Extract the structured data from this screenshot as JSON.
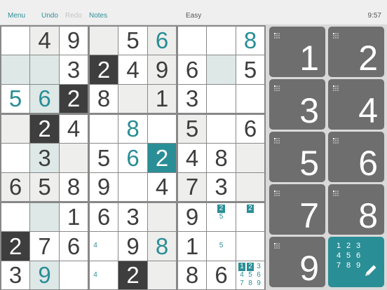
{
  "toolbar": {
    "menu": "Menu",
    "undo": "Undo",
    "redo": "Redo",
    "notes": "Notes",
    "difficulty": "Easy",
    "time": "9:57"
  },
  "colors": {
    "accent": "#2a8e96",
    "given_dark": "#3e3e3e",
    "key": "#6e6e6e"
  },
  "board": [
    [
      {
        "v": "",
        "bg": "w"
      },
      {
        "v": "4",
        "bg": "g"
      },
      {
        "v": "9",
        "bg": "w"
      },
      {
        "v": "",
        "bg": "g"
      },
      {
        "v": "5",
        "bg": "w"
      },
      {
        "v": "6",
        "bg": "g",
        "u": true
      },
      {
        "v": "",
        "bg": "w"
      },
      {
        "v": "",
        "bg": "w"
      },
      {
        "v": "8",
        "bg": "w",
        "u": true
      }
    ],
    [
      {
        "v": "",
        "bg": "b"
      },
      {
        "v": "",
        "bg": "b"
      },
      {
        "v": "3",
        "bg": "w"
      },
      {
        "v": "2",
        "bg": "d"
      },
      {
        "v": "4",
        "bg": "w"
      },
      {
        "v": "9",
        "bg": "g"
      },
      {
        "v": "6",
        "bg": "w"
      },
      {
        "v": "",
        "bg": "b"
      },
      {
        "v": "5",
        "bg": "w"
      }
    ],
    [
      {
        "v": "5",
        "bg": "w",
        "u": true
      },
      {
        "v": "6",
        "bg": "b",
        "u": true
      },
      {
        "v": "2",
        "bg": "d"
      },
      {
        "v": "8",
        "bg": "w"
      },
      {
        "v": "",
        "bg": "g"
      },
      {
        "v": "1",
        "bg": "g"
      },
      {
        "v": "3",
        "bg": "w"
      },
      {
        "v": "",
        "bg": "w"
      },
      {
        "v": "",
        "bg": "w"
      }
    ],
    [
      {
        "v": "",
        "bg": "g"
      },
      {
        "v": "2",
        "bg": "d"
      },
      {
        "v": "4",
        "bg": "w"
      },
      {
        "v": "",
        "bg": "w"
      },
      {
        "v": "8",
        "bg": "w",
        "u": true
      },
      {
        "v": "",
        "bg": "w"
      },
      {
        "v": "5",
        "bg": "g"
      },
      {
        "v": "",
        "bg": "w"
      },
      {
        "v": "6",
        "bg": "w"
      }
    ],
    [
      {
        "v": "",
        "bg": "w"
      },
      {
        "v": "3",
        "bg": "b"
      },
      {
        "v": "",
        "bg": "g"
      },
      {
        "v": "5",
        "bg": "w"
      },
      {
        "v": "6",
        "bg": "w",
        "u": true
      },
      {
        "v": "2",
        "bg": "t"
      },
      {
        "v": "4",
        "bg": "w"
      },
      {
        "v": "8",
        "bg": "w"
      },
      {
        "v": "",
        "bg": "g"
      }
    ],
    [
      {
        "v": "6",
        "bg": "g"
      },
      {
        "v": "5",
        "bg": "g"
      },
      {
        "v": "8",
        "bg": "w"
      },
      {
        "v": "9",
        "bg": "w"
      },
      {
        "v": "",
        "bg": "w"
      },
      {
        "v": "4",
        "bg": "w"
      },
      {
        "v": "7",
        "bg": "g"
      },
      {
        "v": "3",
        "bg": "w"
      },
      {
        "v": "",
        "bg": "g"
      }
    ],
    [
      {
        "v": "",
        "bg": "w"
      },
      {
        "v": "",
        "bg": "b"
      },
      {
        "v": "1",
        "bg": "w"
      },
      {
        "v": "6",
        "bg": "w"
      },
      {
        "v": "3",
        "bg": "w"
      },
      {
        "v": "",
        "bg": "g"
      },
      {
        "v": "9",
        "bg": "w"
      },
      {
        "v": "",
        "bg": "w",
        "n": [
          "",
          "2",
          "",
          "",
          "5",
          "",
          "",
          "",
          ""
        ],
        "h": [
          1
        ]
      },
      {
        "v": "",
        "bg": "w",
        "n": [
          "",
          "2",
          "",
          "",
          "",
          "",
          "",
          "",
          ""
        ],
        "h": [
          1
        ]
      }
    ],
    [
      {
        "v": "2",
        "bg": "d"
      },
      {
        "v": "7",
        "bg": "w"
      },
      {
        "v": "6",
        "bg": "w"
      },
      {
        "v": "",
        "bg": "w",
        "n": [
          "",
          "",
          "",
          "4",
          "",
          "",
          "",
          "",
          ""
        ]
      },
      {
        "v": "9",
        "bg": "w"
      },
      {
        "v": "8",
        "bg": "g",
        "u": true
      },
      {
        "v": "1",
        "bg": "w"
      },
      {
        "v": "",
        "bg": "w",
        "n": [
          "",
          "",
          "",
          "",
          "5",
          "",
          "",
          "",
          ""
        ]
      },
      {
        "v": "",
        "bg": "w"
      }
    ],
    [
      {
        "v": "3",
        "bg": "w"
      },
      {
        "v": "9",
        "bg": "b",
        "u": true
      },
      {
        "v": "",
        "bg": "w"
      },
      {
        "v": "",
        "bg": "w",
        "n": [
          "",
          "",
          "",
          "4",
          "",
          "",
          "",
          "",
          ""
        ]
      },
      {
        "v": "2",
        "bg": "d"
      },
      {
        "v": "",
        "bg": "g"
      },
      {
        "v": "8",
        "bg": "w"
      },
      {
        "v": "6",
        "bg": "w"
      },
      {
        "v": "",
        "bg": "w",
        "n": [
          "1",
          "2",
          "3",
          "4",
          "5",
          "6",
          "7",
          "8",
          "9"
        ],
        "h": [
          0,
          1
        ]
      }
    ]
  ],
  "keypad": [
    {
      "digit": "1",
      "icon": "notes-mode-icon"
    },
    {
      "digit": "2",
      "icon": "notes-mode-icon"
    },
    {
      "digit": "3",
      "icon": "notes-mode-icon"
    },
    {
      "digit": "4",
      "icon": "notes-mode-icon"
    },
    {
      "digit": "5",
      "icon": "notes-mode-icon"
    },
    {
      "digit": "6",
      "icon": "notes-mode-icon"
    },
    {
      "digit": "7",
      "icon": "notes-mode-icon"
    },
    {
      "digit": "8",
      "icon": "notes-mode-icon"
    },
    {
      "digit": "9",
      "icon": "notes-mode-icon"
    }
  ],
  "pencil_key": {
    "digits": [
      "1",
      "2",
      "3",
      "4",
      "5",
      "6",
      "7",
      "8",
      "9"
    ],
    "icon": "pencil-icon"
  }
}
